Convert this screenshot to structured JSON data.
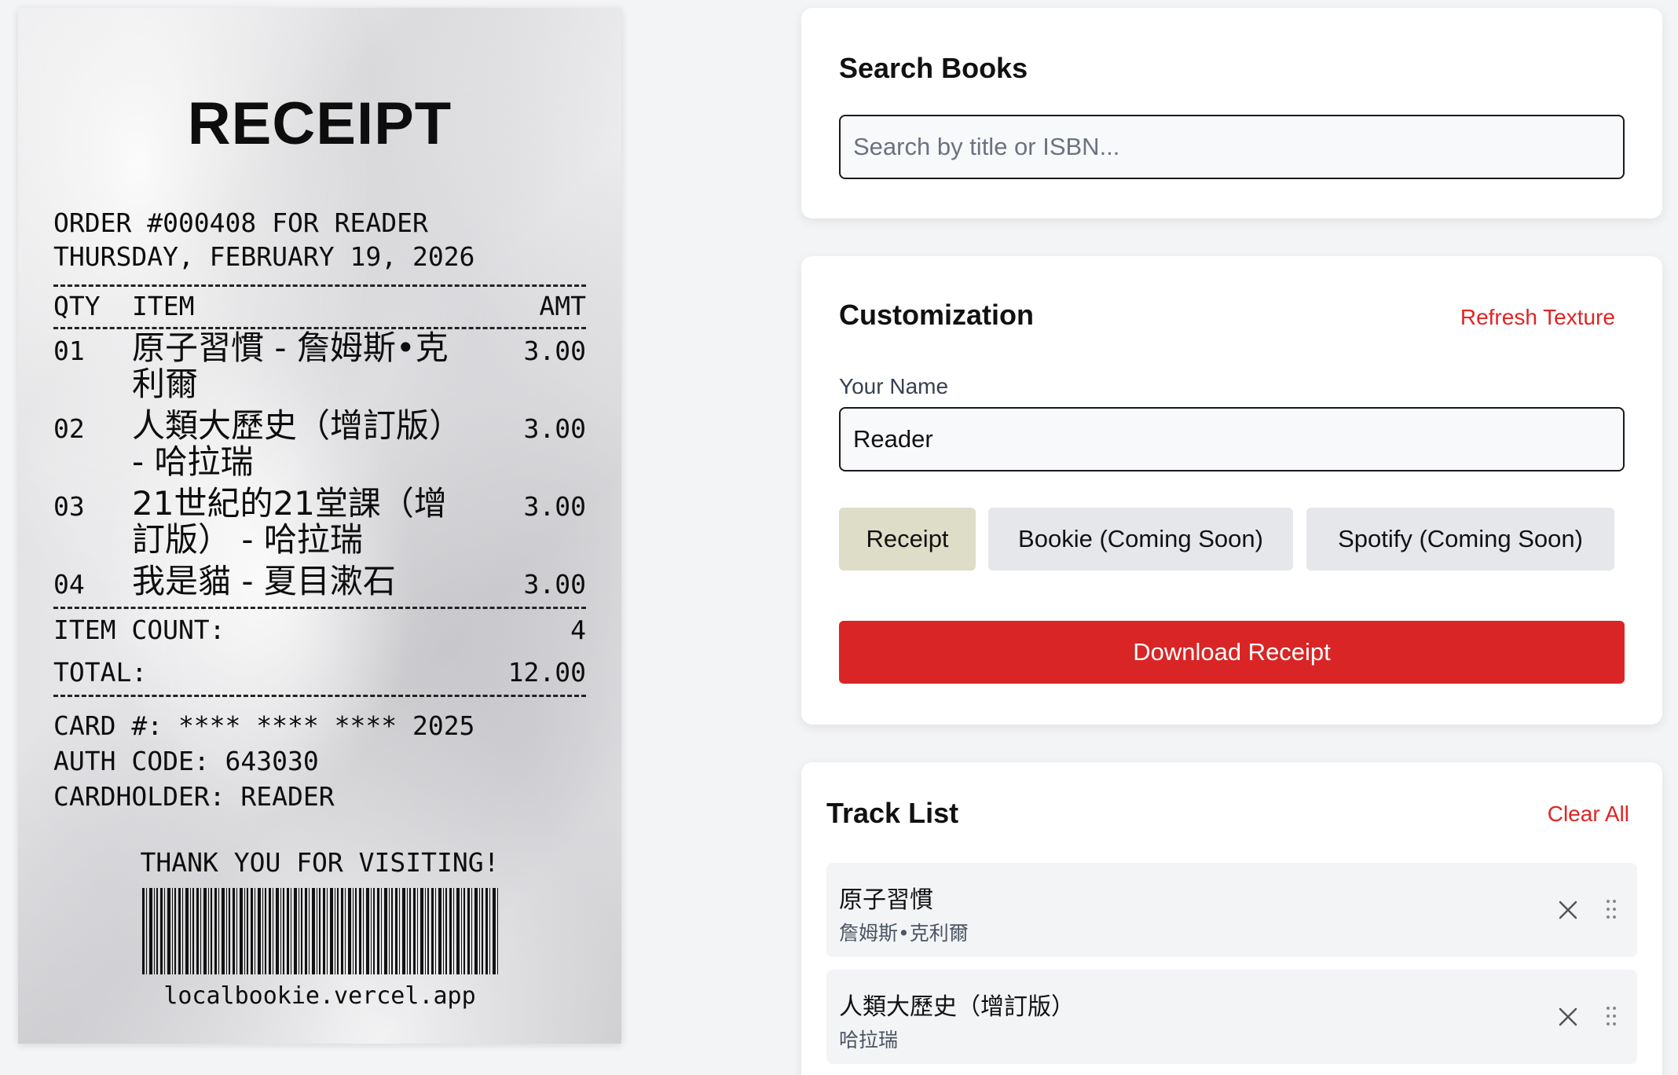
{
  "receipt": {
    "title": "RECEIPT",
    "order_line": "ORDER #000408 FOR READER",
    "date_line": "THURSDAY, FEBRUARY 19, 2026",
    "headers": {
      "qty": "QTY",
      "item": "ITEM",
      "amt": "AMT"
    },
    "items": [
      {
        "qty": "01",
        "item": "原子習慣 - 詹姆斯•克利爾",
        "amt": "3.00"
      },
      {
        "qty": "02",
        "item": "人類大歷史（增訂版） - 哈拉瑞",
        "amt": "3.00"
      },
      {
        "qty": "03",
        "item": "21世紀的21堂課（增訂版） - 哈拉瑞",
        "amt": "3.00"
      },
      {
        "qty": "04",
        "item": "我是貓 - 夏目漱石",
        "amt": "3.00"
      }
    ],
    "item_count_label": "ITEM COUNT:",
    "item_count": "4",
    "total_label": "TOTAL:",
    "total": "12.00",
    "card_line": "CARD #: **** **** **** 2025",
    "auth_line": "AUTH CODE: 643030",
    "cardholder_line": "CARDHOLDER: READER",
    "thank_you": "THANK YOU FOR VISITING!",
    "barcode_text": "localbookie.vercel.app"
  },
  "search": {
    "heading": "Search Books",
    "placeholder": "Search by title or ISBN..."
  },
  "customization": {
    "heading": "Customization",
    "refresh_label": "Refresh Texture",
    "name_label": "Your Name",
    "name_value": "Reader",
    "templates": [
      {
        "label": "Receipt",
        "active": true
      },
      {
        "label": "Bookie (Coming Soon)",
        "active": false
      },
      {
        "label": "Spotify (Coming Soon)",
        "active": false
      }
    ],
    "download_label": "Download Receipt"
  },
  "tracklist": {
    "heading": "Track List",
    "clear_label": "Clear All",
    "tracks": [
      {
        "title": "原子習慣",
        "author": "詹姆斯•克利爾"
      },
      {
        "title": "人類大歷史（增訂版）",
        "author": "哈拉瑞"
      }
    ]
  },
  "colors": {
    "accent_red": "#d92525",
    "link_red": "#e02424",
    "active_template": "#deddc7"
  }
}
